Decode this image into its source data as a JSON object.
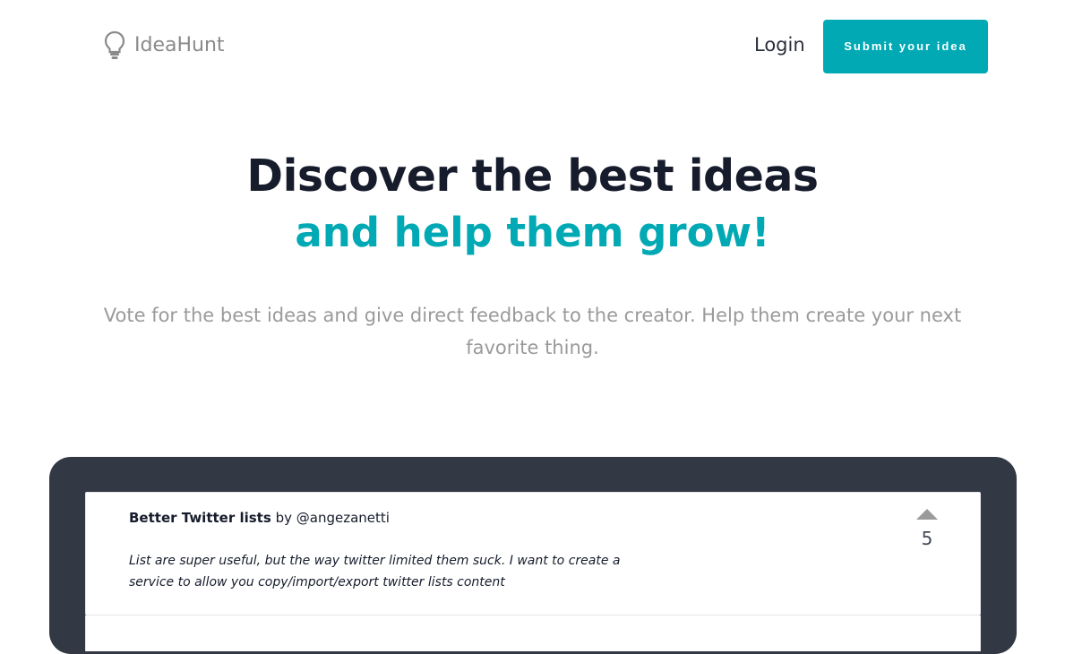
{
  "header": {
    "brand": "IdeaHunt",
    "login_label": "Login",
    "submit_label": "Submit your idea"
  },
  "hero": {
    "title": "Discover the best ideas",
    "subtitle": "and help them grow!",
    "description": "Vote for the best ideas and give direct feedback to the creator. Help them create your next favorite thing."
  },
  "ideas": [
    {
      "title": "Better Twitter lists",
      "by_prefix": "by",
      "author": "@angezanetti",
      "description": "List are super useful, but the way twitter limited them suck. I want to create a service to allow you copy/import/export twitter lists content",
      "votes": "5"
    }
  ],
  "icons": {
    "logo": "lightbulb-icon",
    "upvote": "caret-up-icon"
  },
  "colors": {
    "accent": "#00a9b3",
    "heading": "#161c2b",
    "muted": "#9a9a9a",
    "panel": "#323944"
  }
}
